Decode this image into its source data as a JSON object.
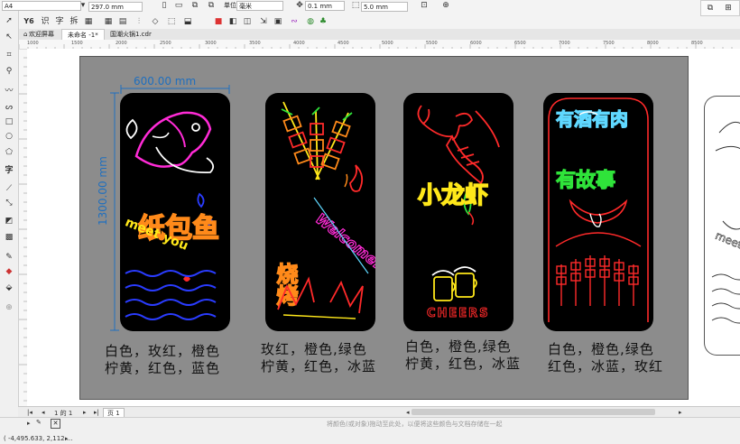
{
  "propbar": {
    "paper_size": "A4",
    "page_height": "297.0 mm",
    "units_label": "毫米",
    "nudge": "0.1 mm",
    "dup_distance": "5.0 mm"
  },
  "tabs": [
    {
      "label": "欢迎屏幕"
    },
    {
      "label": "未命名 -1*"
    },
    {
      "label": "国潮火锅1.cdr"
    }
  ],
  "ruler_marks": [
    "1000",
    "1500",
    "2000",
    "2500",
    "3000",
    "3500",
    "4000",
    "4500",
    "5000",
    "5500",
    "6000",
    "6500",
    "7000",
    "7500",
    "8000",
    "8500"
  ],
  "dimensions": {
    "width": "600.00 mm",
    "height": "1300.00 mm"
  },
  "signs": [
    {
      "caption1": "白色，玫红，橙色",
      "caption2": "柠黄，红色，蓝色",
      "text1": "纸包鱼",
      "text2": "meet you"
    },
    {
      "caption1": "玫红，橙色,绿色",
      "caption2": "柠黄，红色，冰蓝",
      "text1": "烧烤",
      "text2": "Welcome!"
    },
    {
      "caption1": "白色，橙色,绿色",
      "caption2": "柠黄，红色，冰蓝",
      "text1": "小龙虾",
      "text2": "CHEERS"
    },
    {
      "caption1": "白色，橙色,绿色",
      "caption2": "红色，冰蓝，玫红",
      "text1": "有酒有肉",
      "text2": "有故事"
    }
  ],
  "page_nav": {
    "position": "1 的 1",
    "page_tab": "页 1"
  },
  "status": {
    "coords": "( -4,495.633, 2,112....",
    "hint": "将颜色(或对象)拖动至此处，以便将这些颜色与文档存储在一起"
  },
  "colors": {
    "page_bg": "#8c8c8c",
    "dim_blue": "#1f6fbf",
    "neon_pink": "#ff2bd6",
    "neon_red": "#ff2a2a",
    "neon_orange": "#ff8a1a",
    "neon_yellow": "#ffe81a",
    "neon_green": "#2fe33a",
    "neon_blue": "#2a3cff",
    "neon_iceblue": "#5fd8ff",
    "neon_white": "#ffffff"
  }
}
